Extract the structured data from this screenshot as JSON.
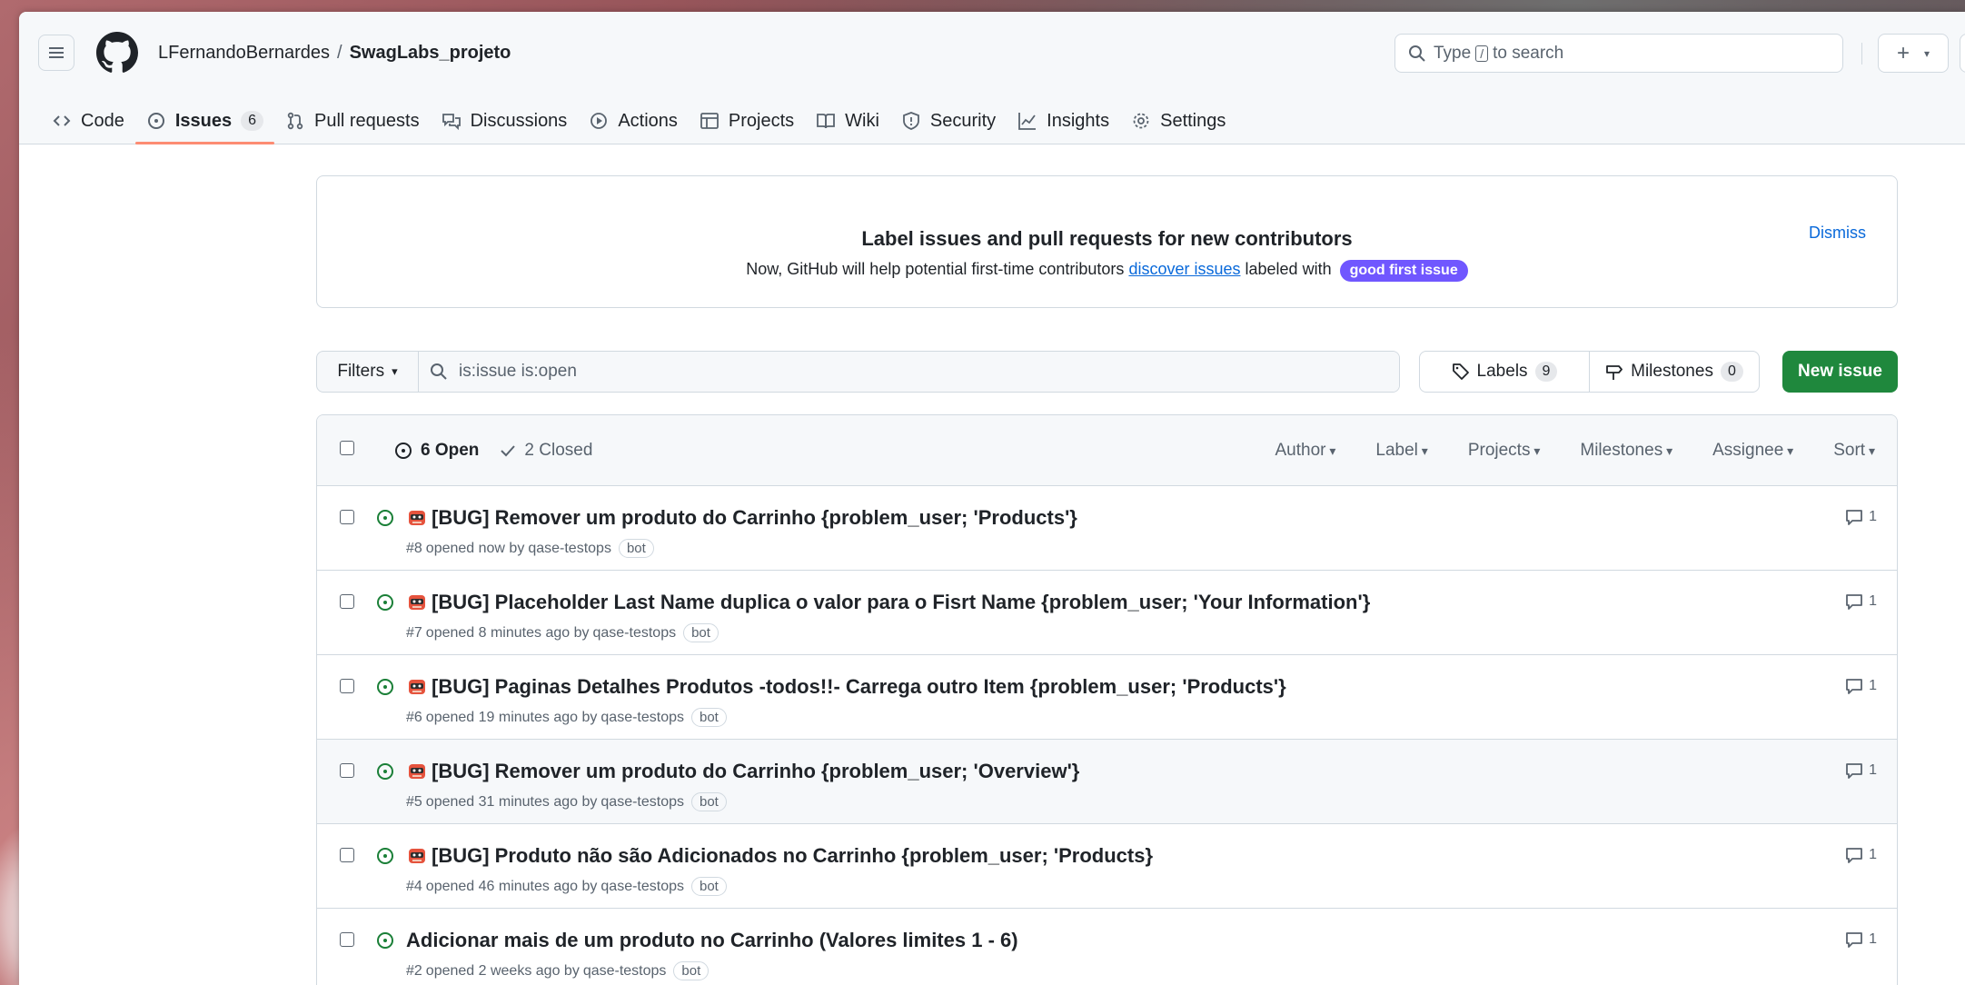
{
  "header": {
    "owner": "LFernandoBernardes",
    "separator": "/",
    "repo": "SwagLabs_projeto",
    "search_prefix": "Type",
    "search_key": "/",
    "search_suffix": "to search",
    "plus": "+"
  },
  "nav": [
    {
      "label": "Code",
      "icon": "code-icon"
    },
    {
      "label": "Issues",
      "icon": "issue-opened-icon",
      "count": "6",
      "active": true
    },
    {
      "label": "Pull requests",
      "icon": "git-pull-request-icon"
    },
    {
      "label": "Discussions",
      "icon": "comment-discussion-icon"
    },
    {
      "label": "Actions",
      "icon": "play-icon"
    },
    {
      "label": "Projects",
      "icon": "table-icon"
    },
    {
      "label": "Wiki",
      "icon": "book-icon"
    },
    {
      "label": "Security",
      "icon": "shield-icon"
    },
    {
      "label": "Insights",
      "icon": "graph-icon"
    },
    {
      "label": "Settings",
      "icon": "gear-icon"
    }
  ],
  "banner": {
    "title": "Label issues and pull requests for new contributors",
    "text_before": "Now, GitHub will help potential first-time contributors",
    "link": "discover issues",
    "text_after": "labeled with",
    "label": "good first issue",
    "dismiss": "Dismiss"
  },
  "toolbar": {
    "filters": "Filters",
    "query": "is:issue is:open",
    "labels": "Labels",
    "labels_count": "9",
    "milestones": "Milestones",
    "milestones_count": "0",
    "new_issue": "New issue"
  },
  "list_header": {
    "open": "6 Open",
    "closed": "2 Closed",
    "filters": [
      "Author",
      "Label",
      "Projects",
      "Milestones",
      "Assignee",
      "Sort"
    ]
  },
  "issues": [
    {
      "title": "[BUG] Remover um produto do Carrinho {problem_user; 'Products'}",
      "emoji": true,
      "number": "#8",
      "opened": "opened now by",
      "author": "qase-testops",
      "badge": "bot",
      "comments": "1"
    },
    {
      "title": "[BUG] Placeholder Last Name duplica o valor para o Fisrt Name {problem_user; 'Your Information'}",
      "emoji": true,
      "number": "#7",
      "opened": "opened 8 minutes ago by",
      "author": "qase-testops",
      "badge": "bot",
      "comments": "1"
    },
    {
      "title": "[BUG] Paginas Detalhes Produtos -todos!!- Carrega outro Item {problem_user; 'Products'}",
      "emoji": true,
      "number": "#6",
      "opened": "opened 19 minutes ago by",
      "author": "qase-testops",
      "badge": "bot",
      "comments": "1"
    },
    {
      "title": "[BUG] Remover um produto do Carrinho {problem_user; 'Overview'}",
      "emoji": true,
      "number": "#5",
      "opened": "opened 31 minutes ago by",
      "author": "qase-testops",
      "badge": "bot",
      "comments": "1"
    },
    {
      "title": "[BUG] Produto não são Adicionados no Carrinho {problem_user; 'Products}",
      "emoji": true,
      "number": "#4",
      "opened": "opened 46 minutes ago by",
      "author": "qase-testops",
      "badge": "bot",
      "comments": "1"
    },
    {
      "title": "Adicionar mais de um produto no Carrinho (Valores limites 1 - 6)",
      "emoji": false,
      "number": "#2",
      "opened": "opened 2 weeks ago by",
      "author": "qase-testops",
      "badge": "bot",
      "comments": "1"
    }
  ],
  "colors": {
    "accent": "#0969da",
    "open_green": "#1a7f37",
    "new_issue_green": "#1f883d",
    "tab_underline": "#fd8c73",
    "good_first_issue": "#7057ff"
  }
}
